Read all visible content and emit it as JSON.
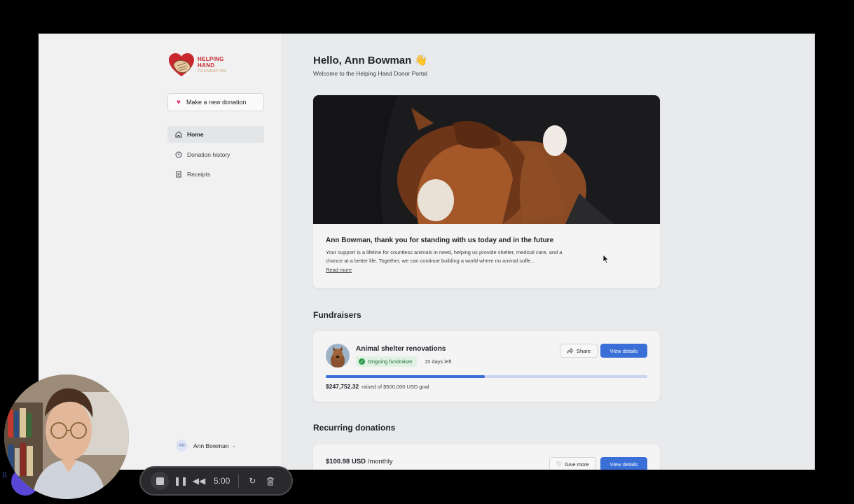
{
  "brand": {
    "line1": "HELPING",
    "line2": "HAND",
    "line3": "FOUNDATION"
  },
  "sidebar": {
    "donate_label": "Make a new donation",
    "items": [
      {
        "label": "Home",
        "icon": "home-icon"
      },
      {
        "label": "Donation history",
        "icon": "clock-icon"
      },
      {
        "label": "Receipts",
        "icon": "receipt-icon"
      }
    ],
    "user": {
      "initials": "AN",
      "name": "Ann Bowman"
    }
  },
  "main": {
    "greeting": "Hello, Ann Bowman",
    "greeting_emoji": "👋",
    "welcome": "Welcome to the Helping Hand Donor Portal",
    "hero": {
      "title": "Ann Bowman, thank you for standing with us today and in the future",
      "body": "Your support is a lifeline for countless animals in need, helping us provide shelter, medical care, and a chance at a better life. Together, we can continue building a world where no animal suffe...",
      "read_more": "Read more"
    },
    "fundraisers_heading": "Fundraisers",
    "fundraiser": {
      "title": "Animal shelter renovations",
      "status": "Ongoing fundraiser",
      "days_left": "15 days left",
      "share_label": "Share",
      "view_label": "View details",
      "raised_amount": "$247,752.32",
      "raised_text": "raised of $500,000 USD goal",
      "progress_fraction": 0.495
    },
    "recurring_heading": "Recurring donations",
    "recurring": {
      "amount": "$100.98 USD",
      "period": "/monthly",
      "give_more_label": "Give more",
      "view_label": "View details"
    }
  },
  "recorder": {
    "timer": "5:00"
  },
  "colors": {
    "accent": "#3a6fd8",
    "heart": "#e8336d",
    "success": "#2e9a4e",
    "brand_red": "#c8272e"
  }
}
